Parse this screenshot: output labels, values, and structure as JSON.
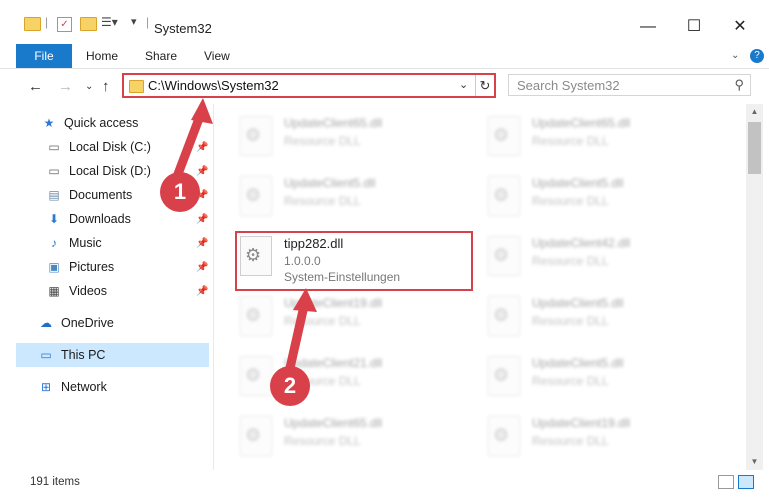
{
  "window": {
    "title": "System32",
    "controls": {
      "minimize": "—",
      "maximize": "☐",
      "close": "✕"
    }
  },
  "ribbon": {
    "tabs": [
      "File",
      "Home",
      "Share",
      "View"
    ]
  },
  "address": {
    "path": "C:\\Windows\\System32",
    "search_placeholder": "Search System32"
  },
  "nav_pane": {
    "items": [
      {
        "label": "Quick access",
        "icon": "star-icon",
        "pinned": false
      },
      {
        "label": "Local Disk (C:)",
        "icon": "drive-icon",
        "pinned": true
      },
      {
        "label": "Local Disk (D:)",
        "icon": "drive-icon",
        "pinned": true
      },
      {
        "label": "Documents",
        "icon": "documents-icon",
        "pinned": true
      },
      {
        "label": "Downloads",
        "icon": "download-icon",
        "pinned": true
      },
      {
        "label": "Music",
        "icon": "music-icon",
        "pinned": true
      },
      {
        "label": "Pictures",
        "icon": "pictures-icon",
        "pinned": true
      },
      {
        "label": "Videos",
        "icon": "videos-icon",
        "pinned": true
      },
      {
        "label": "OneDrive",
        "icon": "cloud-icon",
        "pinned": false
      },
      {
        "label": "This PC",
        "icon": "computer-icon",
        "pinned": false,
        "selected": true
      },
      {
        "label": "Network",
        "icon": "network-icon",
        "pinned": false
      }
    ]
  },
  "files": {
    "highlighted": {
      "name": "tipp282.dll",
      "version": "1.0.0.0",
      "description": "System-Einstellungen"
    },
    "blurred": [
      {
        "name": "UpdateClient65.dll",
        "desc": "Resource DLL"
      },
      {
        "name": "UpdateClient65.dll",
        "desc": "Resource DLL"
      },
      {
        "name": "UpdateClient5.dll",
        "desc": "Resource DLL"
      },
      {
        "name": "UpdateClient5.dll",
        "desc": "Resource DLL"
      },
      {
        "name": "UpdateClient42.dll",
        "desc": "Resource DLL"
      },
      {
        "name": "UpdateClient19.dll",
        "desc": "Resource DLL"
      },
      {
        "name": "UpdateClient5.dll",
        "desc": "Resource DLL"
      },
      {
        "name": "UpdateClient21.dll",
        "desc": "Resource DLL"
      },
      {
        "name": "UpdateClient5.dll",
        "desc": "Resource DLL"
      },
      {
        "name": "UpdateClient65.dll",
        "desc": "Resource DLL"
      },
      {
        "name": "UpdateClient19.dll",
        "desc": "Resource DLL"
      }
    ]
  },
  "status": {
    "item_count": "191 items"
  },
  "annotations": {
    "step1": "1",
    "step2": "2",
    "accent_color": "#d9414a"
  }
}
